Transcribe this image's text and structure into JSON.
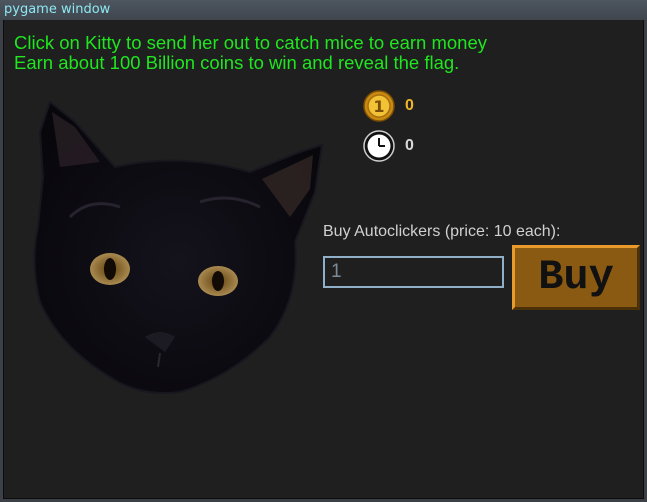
{
  "window": {
    "title": "pygame window"
  },
  "instructions": {
    "line1": "Click on Kitty to send her out to catch mice to earn money",
    "line2": "Earn about 100 Billion coins to win and reveal the flag."
  },
  "counters": {
    "coins": {
      "icon": "gold-coin-icon",
      "value": "0",
      "coin_glyph": "1"
    },
    "autoclickers": {
      "icon": "clock-icon",
      "value": "0"
    }
  },
  "shop": {
    "label": "Buy Autoclickers (price: 10 each):",
    "quantity_value": "1",
    "buy_label": "Buy"
  },
  "colors": {
    "instructions": "#1fe61f",
    "coins": "#f0b429",
    "background": "#1f1f1f",
    "button": "#8a5a12"
  }
}
